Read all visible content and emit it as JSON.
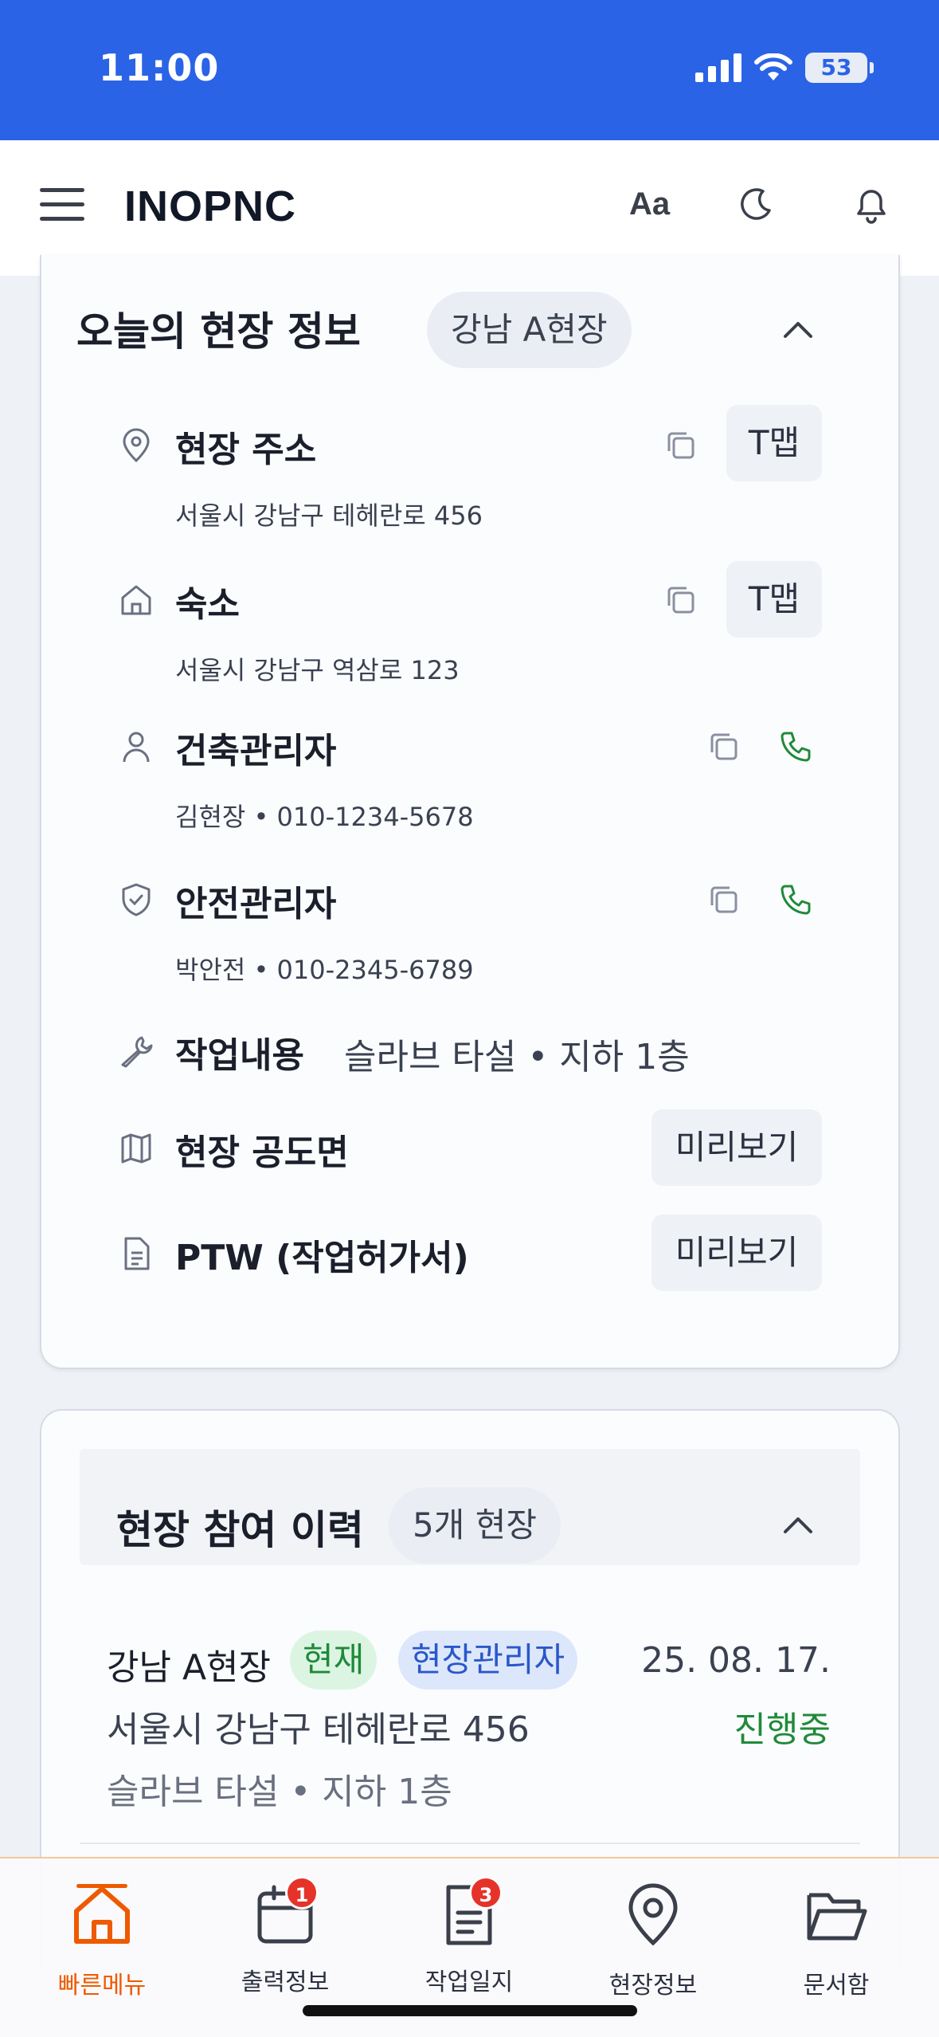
{
  "status_bar": {
    "time": "11:00",
    "battery": "53"
  },
  "header": {
    "title": "INOPNC",
    "font_button": "Aa"
  },
  "today_site": {
    "title": "오늘의 현장 정보",
    "site_chip": "강남 A현장",
    "rows": {
      "address": {
        "label": "현장 주소",
        "value": "서울시 강남구 테헤란로 456",
        "tmap": "T맵"
      },
      "lodging": {
        "label": "숙소",
        "value": "서울시 강남구 역삼로 123",
        "tmap": "T맵"
      },
      "construction_manager": {
        "label": "건축관리자",
        "value": "김현장 • 010-1234-5678"
      },
      "safety_manager": {
        "label": "안전관리자",
        "value": "박안전 • 010-2345-6789"
      },
      "work": {
        "label": "작업내용",
        "value": "슬라브 타설 • 지하 1층"
      },
      "drawing": {
        "label": "현장 공도면",
        "button": "미리보기"
      },
      "ptw": {
        "label": "PTW (작업허가서)",
        "button": "미리보기"
      }
    }
  },
  "history": {
    "title": "현장 참여 이력",
    "count_chip": "5개 현장",
    "items": [
      {
        "name": "강남 A현장",
        "tag_current": "현재",
        "tag_role": "현장관리자",
        "date": "25. 08. 17.",
        "address": "서울시 강남구 테헤란로 456",
        "status": "진행중",
        "work": "슬라브 타설 • 지하 1층"
      }
    ]
  },
  "bottom_nav": {
    "items": [
      {
        "label": "빠른메뉴",
        "icon": "home-icon"
      },
      {
        "label": "출력정보",
        "icon": "calendar-icon",
        "badge": "1"
      },
      {
        "label": "작업일지",
        "icon": "document-icon",
        "badge": "3"
      },
      {
        "label": "현장정보",
        "icon": "location-pin-icon"
      },
      {
        "label": "문서함",
        "icon": "folder-open-icon"
      }
    ]
  },
  "colors": {
    "status_bar": "#2a63e6",
    "accent": "#ee5a00",
    "success": "#1f8a3a",
    "badge": "#e5332a"
  }
}
